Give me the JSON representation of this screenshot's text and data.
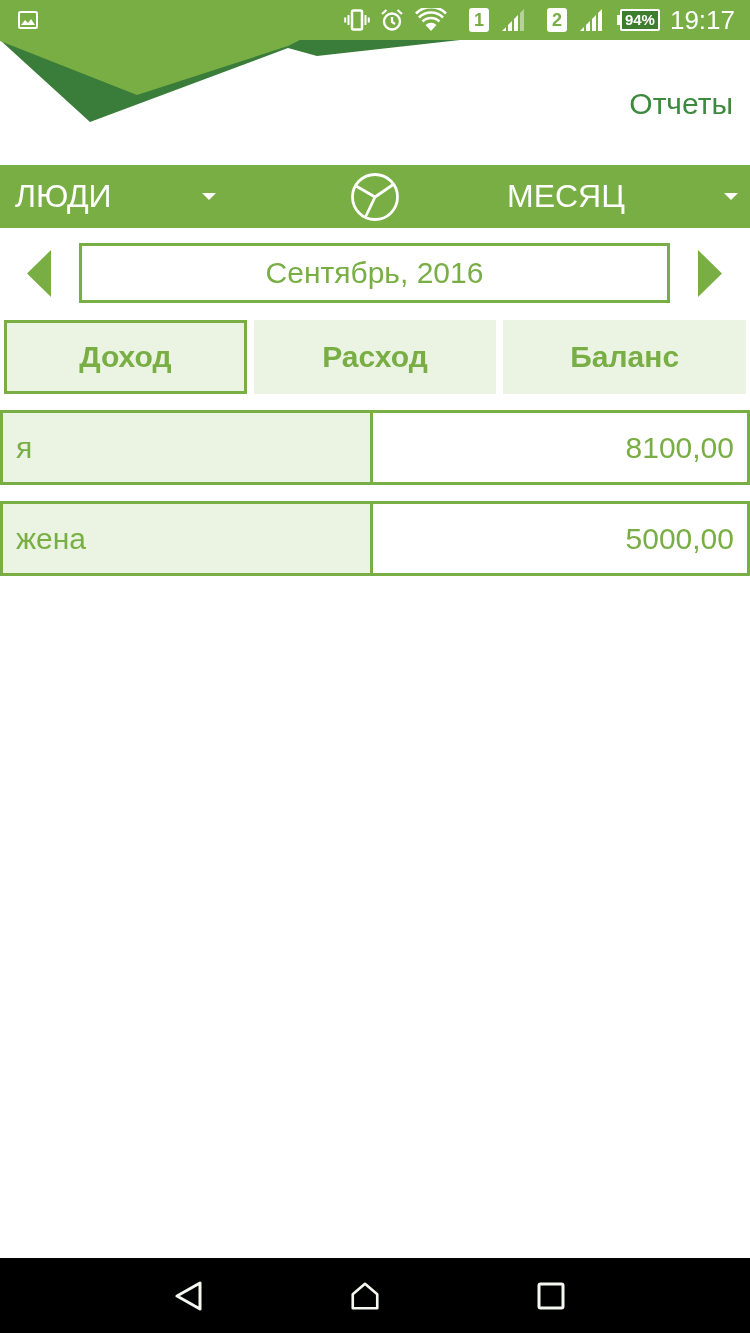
{
  "status_bar": {
    "sim_slots": [
      {
        "label": "1"
      },
      {
        "label": "2"
      }
    ],
    "battery": "94%",
    "time": "19:17"
  },
  "header": {
    "title": "Отчеты"
  },
  "toolbar": {
    "group_by": "ЛЮДИ",
    "period": "МЕСЯЦ"
  },
  "date_nav": {
    "value": "Сентябрь, 2016"
  },
  "tabs": [
    {
      "label": "Доход",
      "selected": true
    },
    {
      "label": "Расход",
      "selected": false
    },
    {
      "label": "Баланс",
      "selected": false
    }
  ],
  "rows": [
    {
      "name": "я",
      "amount": "8100,00"
    },
    {
      "name": "жена",
      "amount": "5000,00"
    }
  ]
}
